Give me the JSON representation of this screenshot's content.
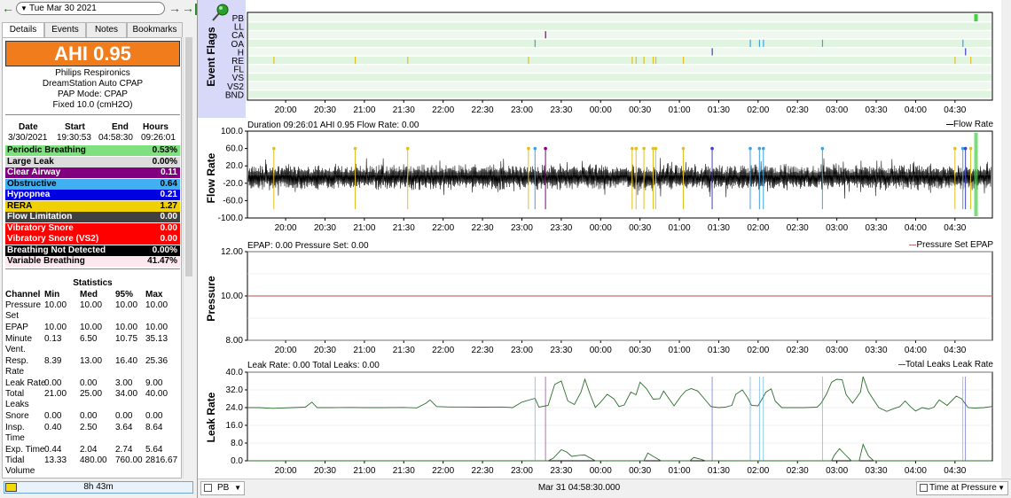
{
  "date_bar": {
    "date": "Tue Mar 30 2021",
    "prev_label": "←",
    "next_label": "→",
    "last_label": "→|"
  },
  "tabs": [
    "Details",
    "Events",
    "Notes",
    "Bookmarks"
  ],
  "details": {
    "ahi": "AHI 0.95",
    "ahi_color": "#f07c1c",
    "device": [
      "Philips Respironics",
      "DreamStation Auto CPAP",
      "PAP Mode: CPAP",
      "Fixed 10.0 (cmH2O)"
    ],
    "session_headers": [
      "Date",
      "Start",
      "End",
      "Hours"
    ],
    "session_values": [
      "3/30/2021",
      "19:30:53",
      "04:58:30",
      "09:26:01"
    ],
    "indices": [
      {
        "label": "Periodic Breathing",
        "value": "0.53%",
        "bg": "#7fe07f",
        "fg": "#000000"
      },
      {
        "label": "Large Leak",
        "value": "0.00%",
        "bg": "#dcdcdc",
        "fg": "#000000"
      },
      {
        "label": "Clear Airway",
        "value": "0.11",
        "bg": "#800080",
        "fg": "#ffffff"
      },
      {
        "label": "Obstructive",
        "value": "0.64",
        "bg": "#40b0f0",
        "fg": "#000000"
      },
      {
        "label": "Hypopnea",
        "value": "0.21",
        "bg": "#0000e0",
        "fg": "#ffffff"
      },
      {
        "label": "RERA",
        "value": "1.27",
        "bg": "#f0d000",
        "fg": "#000000"
      },
      {
        "label": "Flow Limitation",
        "value": "0.00",
        "bg": "#404040",
        "fg": "#ffffff"
      },
      {
        "label": "Vibratory Snore",
        "value": "0.00",
        "bg": "#ff0000",
        "fg": "#ffffff"
      },
      {
        "label": "Vibratory Snore (VS2)",
        "value": "0.00",
        "bg": "#ff0000",
        "fg": "#ffffff"
      },
      {
        "label": "Breathing Not Detected",
        "value": "0.00%",
        "bg": "#000000",
        "fg": "#ffffff"
      },
      {
        "label": "Variable Breathing",
        "value": "41.47%",
        "bg": "#fde8f0",
        "fg": "#000000"
      }
    ],
    "stats_title": "Statistics",
    "stats_headers": [
      "Channel",
      "Min",
      "Med",
      "95%",
      "Max"
    ],
    "stats_rows": [
      {
        "name": [
          "Pressure",
          "Set"
        ],
        "min": "10.00",
        "med": "10.00",
        "p95": "10.00",
        "max": "10.00"
      },
      {
        "name": [
          "EPAP"
        ],
        "min": "10.00",
        "med": "10.00",
        "p95": "10.00",
        "max": "10.00"
      },
      {
        "name": [
          "Minute",
          "Vent."
        ],
        "min": "0.13",
        "med": "6.50",
        "p95": "10.75",
        "max": "35.13"
      },
      {
        "name": [
          "Resp.",
          "Rate"
        ],
        "min": "8.39",
        "med": "13.00",
        "p95": "16.40",
        "max": "25.36"
      },
      {
        "name": [
          "Leak Rate"
        ],
        "min": "0.00",
        "med": "0.00",
        "p95": "3.00",
        "max": "9.00"
      },
      {
        "name": [
          "Total",
          "Leaks"
        ],
        "min": "21.00",
        "med": "25.00",
        "p95": "34.00",
        "max": "40.00"
      },
      {
        "name": [
          "Snore"
        ],
        "min": "0.00",
        "med": "0.00",
        "p95": "0.00",
        "max": "0.00"
      },
      {
        "name": [
          "Insp.",
          "Time"
        ],
        "min": "0.40",
        "med": "2.50",
        "p95": "3.64",
        "max": "8.64"
      },
      {
        "name": [
          "Exp. Time"
        ],
        "min": "0.44",
        "med": "2.04",
        "p95": "2.74",
        "max": "5.64"
      },
      {
        "name": [
          "Tidal",
          "Volume"
        ],
        "min": "13.33",
        "med": "480.00",
        "p95": "760.00",
        "max": "2816.67"
      }
    ]
  },
  "bottom_left": {
    "progress_text": "8h 43m",
    "progress_fraction": 0.06
  },
  "time_axis": [
    "20:00",
    "20:30",
    "21:00",
    "21:30",
    "22:00",
    "22:30",
    "23:00",
    "23:30",
    "00:00",
    "00:30",
    "01:00",
    "01:30",
    "02:00",
    "02:30",
    "03:00",
    "03:30",
    "04:00",
    "04:30"
  ],
  "event_flags": {
    "ylabel": "Event Flags",
    "channels": [
      "PB",
      "LL",
      "CA",
      "OA",
      "H",
      "RE",
      "FL",
      "VS",
      "VS2",
      "BND"
    ],
    "marks": {
      "PB": [
        {
          "t": "04:46",
          "color": "#40d040",
          "wide": true
        }
      ],
      "CA": [
        {
          "t": "23:18",
          "color": "#800080"
        }
      ],
      "OA": [
        {
          "t": "23:10",
          "color": "#40a0e0"
        },
        {
          "t": "01:54",
          "color": "#40a0e0"
        },
        {
          "t": "02:01",
          "color": "#40a0e0"
        },
        {
          "t": "02:04",
          "color": "#40a0e0"
        },
        {
          "t": "02:49",
          "color": "#40a0e0"
        },
        {
          "t": "04:36",
          "color": "#40a0e0"
        }
      ],
      "H": [
        {
          "t": "01:25",
          "color": "#4040c0"
        },
        {
          "t": "04:38",
          "color": "#4040c0"
        }
      ],
      "RE": [
        {
          "t": "19:51",
          "color": "#e0c020"
        },
        {
          "t": "20:53",
          "color": "#e0c020"
        },
        {
          "t": "21:33",
          "color": "#e0c020"
        },
        {
          "t": "23:05",
          "color": "#e0c020"
        },
        {
          "t": "00:24",
          "color": "#e0c020"
        },
        {
          "t": "00:27",
          "color": "#e0c020"
        },
        {
          "t": "00:33",
          "color": "#e0c020"
        },
        {
          "t": "00:40",
          "color": "#e0c020"
        },
        {
          "t": "00:42",
          "color": "#e0c020"
        },
        {
          "t": "01:03",
          "color": "#e0c020"
        },
        {
          "t": "04:30",
          "color": "#e0c020"
        },
        {
          "t": "04:42",
          "color": "#e0c020"
        }
      ]
    }
  },
  "flow": {
    "ylabel": "Flow Rate",
    "title": "Duration 09:26:01 AHI 0.95 Flow Rate: 0.00",
    "legend": "Flow Rate",
    "yticks": [
      "100.0",
      "60.0",
      "20.0",
      "-20.0",
      "-60.0",
      "-100.0"
    ],
    "ylim": [
      -100,
      100
    ]
  },
  "pressure": {
    "ylabel": "Pressure",
    "title": "EPAP: 0.00 Pressure Set: 0.00",
    "legend": "Pressure Set EPAP",
    "yticks": [
      "12.00",
      "10.00",
      "8.00"
    ],
    "ylim": [
      8,
      12
    ],
    "value": 10.0,
    "line_color": "#c07070"
  },
  "leak": {
    "ylabel": "Leak Rate",
    "title": "Leak Rate: 0.00 Total Leaks: 0.00",
    "legend": "Total Leaks Leak Rate",
    "yticks": [
      "40.0",
      "32.0",
      "24.0",
      "16.0",
      "8.0",
      "0.0"
    ],
    "ylim": [
      0,
      40
    ],
    "line_color": "#2d6e2d",
    "total_leaks": [
      [
        "19:31",
        24
      ],
      [
        "19:40",
        24
      ],
      [
        "19:50",
        23.7
      ],
      [
        "20:05",
        24
      ],
      [
        "20:15",
        24.2
      ],
      [
        "20:20",
        26.5
      ],
      [
        "20:24",
        24
      ],
      [
        "20:35",
        24
      ],
      [
        "20:50",
        24.1
      ],
      [
        "21:00",
        24
      ],
      [
        "21:15",
        24
      ],
      [
        "21:30",
        24.1
      ],
      [
        "21:40",
        23.9
      ],
      [
        "21:47",
        26
      ],
      [
        "21:50",
        27.5
      ],
      [
        "21:55",
        24.5
      ],
      [
        "22:05",
        24.3
      ],
      [
        "22:15",
        24.3
      ],
      [
        "22:30",
        24.2
      ],
      [
        "22:45",
        24.3
      ],
      [
        "22:53",
        24
      ],
      [
        "23:00",
        26.5
      ],
      [
        "23:10",
        28.2
      ],
      [
        "23:13",
        24.2
      ],
      [
        "23:20",
        25
      ],
      [
        "23:25",
        34.5
      ],
      [
        "23:30",
        36
      ],
      [
        "23:35",
        27
      ],
      [
        "23:40",
        25.4
      ],
      [
        "23:45",
        31
      ],
      [
        "23:48",
        36.8
      ],
      [
        "23:52",
        30
      ],
      [
        "23:56",
        24.1
      ],
      [
        "00:00",
        26.5
      ],
      [
        "00:05",
        30
      ],
      [
        "00:10",
        28
      ],
      [
        "00:14",
        24.5
      ],
      [
        "00:18",
        25.2
      ],
      [
        "00:23",
        31
      ],
      [
        "00:27",
        29.8
      ],
      [
        "00:30",
        35.5
      ],
      [
        "00:35",
        32.5
      ],
      [
        "00:40",
        27.8
      ],
      [
        "00:45",
        28
      ],
      [
        "00:48",
        31.5
      ],
      [
        "00:52",
        28.1
      ],
      [
        "00:56",
        24.8
      ],
      [
        "01:01",
        29
      ],
      [
        "01:05",
        31.6
      ],
      [
        "01:09",
        32.6
      ],
      [
        "01:14",
        31.5
      ],
      [
        "01:19",
        28
      ],
      [
        "01:24",
        24.5
      ],
      [
        "01:30",
        24
      ],
      [
        "01:35",
        24.2
      ],
      [
        "01:40",
        25
      ],
      [
        "01:43",
        30
      ],
      [
        "01:48",
        32
      ],
      [
        "01:52",
        28.5
      ],
      [
        "01:55",
        25
      ],
      [
        "02:00",
        24.8
      ],
      [
        "02:06",
        31
      ],
      [
        "02:10",
        32.5
      ],
      [
        "02:13",
        27
      ],
      [
        "02:18",
        24
      ],
      [
        "02:25",
        24
      ],
      [
        "02:35",
        24
      ],
      [
        "02:45",
        24.2
      ],
      [
        "02:48",
        26
      ],
      [
        "02:52",
        30
      ],
      [
        "02:56",
        35.5
      ],
      [
        "03:00",
        36.8
      ],
      [
        "03:04",
        36.6
      ],
      [
        "03:07",
        30
      ],
      [
        "03:12",
        26
      ],
      [
        "03:18",
        31
      ],
      [
        "03:20",
        38
      ],
      [
        "03:24",
        31.2
      ],
      [
        "03:28",
        27.5
      ],
      [
        "03:32",
        24
      ],
      [
        "03:38",
        22.3
      ],
      [
        "03:43",
        23.5
      ],
      [
        "03:48",
        24.5
      ],
      [
        "03:52",
        27
      ],
      [
        "03:56",
        24.5
      ],
      [
        "04:00",
        22.5
      ],
      [
        "04:05",
        24
      ],
      [
        "04:10",
        23.4
      ],
      [
        "04:14",
        24.2
      ],
      [
        "04:18",
        27.5
      ],
      [
        "04:24",
        25
      ],
      [
        "04:31",
        29.2
      ],
      [
        "04:35",
        28
      ],
      [
        "04:40",
        24
      ],
      [
        "04:45",
        23.8
      ],
      [
        "04:52",
        24
      ],
      [
        "04:58",
        24.5
      ]
    ],
    "leak_rate": [
      [
        "19:31",
        0
      ],
      [
        "23:20",
        0
      ],
      [
        "23:24",
        1.2
      ],
      [
        "23:30",
        5
      ],
      [
        "23:34",
        4
      ],
      [
        "23:38",
        2
      ],
      [
        "23:44",
        2.5
      ],
      [
        "23:48",
        2.6
      ],
      [
        "23:56",
        0
      ],
      [
        "00:33",
        0
      ],
      [
        "00:36",
        3.5
      ],
      [
        "00:40",
        2
      ],
      [
        "00:46",
        0
      ],
      [
        "01:08",
        0
      ],
      [
        "01:11",
        1.5
      ],
      [
        "01:16",
        0.8
      ],
      [
        "01:20",
        0
      ],
      [
        "02:56",
        0
      ],
      [
        "02:58",
        2.5
      ],
      [
        "03:02",
        5.5
      ],
      [
        "03:06",
        3
      ],
      [
        "03:11",
        0
      ],
      [
        "03:17",
        0
      ],
      [
        "03:20",
        7.4
      ],
      [
        "03:24",
        2.2
      ],
      [
        "03:28",
        0
      ],
      [
        "04:58",
        0
      ]
    ]
  },
  "status_bar": {
    "select_label": "PB",
    "time": "Mar 31 04:58:30.000",
    "time_at_pressure": "Time at Pressure"
  }
}
